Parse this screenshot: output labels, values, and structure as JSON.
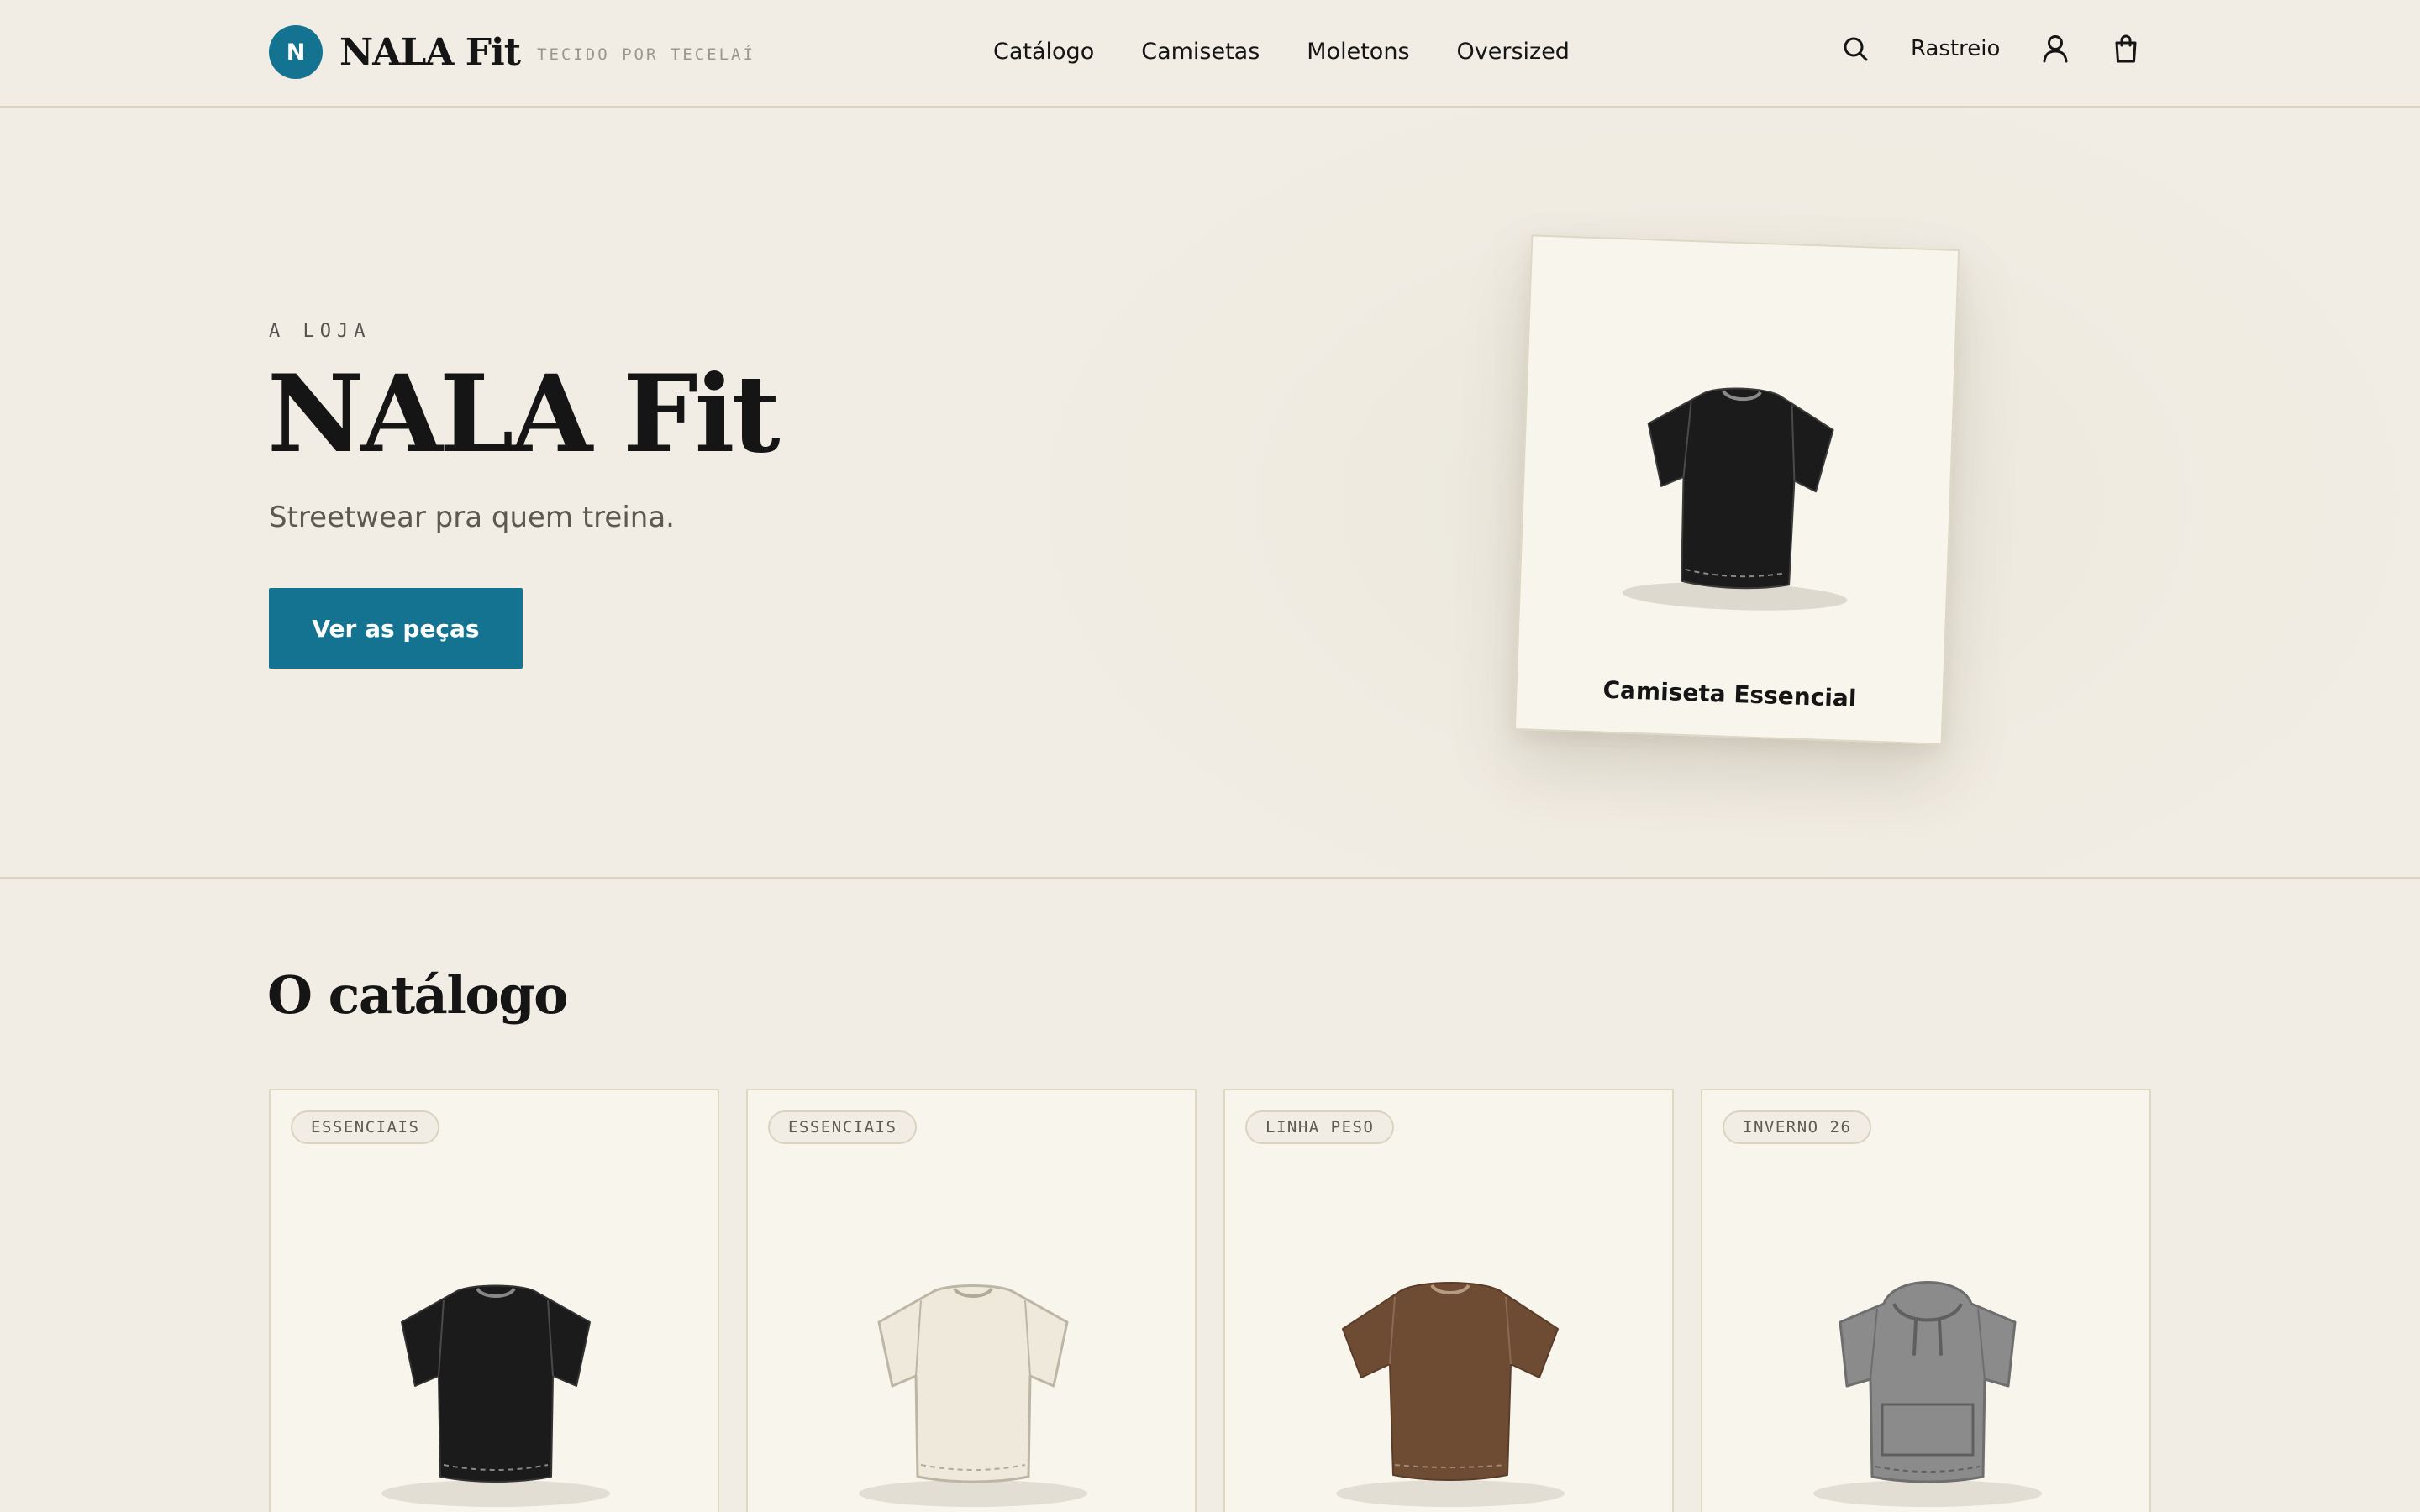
{
  "header": {
    "logo_letter": "N",
    "brand_name": "NALA Fit",
    "brand_tagline": "TECIDO POR TECELAÍ",
    "nav": [
      "Catálogo",
      "Camisetas",
      "Moletons",
      "Oversized"
    ],
    "tracking_label": "Rastreio",
    "icons": [
      "search-icon",
      "user-icon",
      "shopping-bag-icon"
    ]
  },
  "hero": {
    "eyebrow": "A LOJA",
    "title": "NALA Fit",
    "subtitle": "Streetwear pra quem treina.",
    "cta_label": "Ver as peças",
    "featured": {
      "label": "Camiseta Essencial",
      "color": "#1b1b1b"
    }
  },
  "catalog": {
    "title": "O catálogo",
    "products": [
      {
        "badge": "ESSENCIAIS",
        "type": "tshirt",
        "color": "#1b1b1b"
      },
      {
        "badge": "ESSENCIAIS",
        "type": "tshirt",
        "color": "#efe9dc"
      },
      {
        "badge": "LINHA PESO",
        "type": "tshirt-oversized",
        "color": "#6e4c34"
      },
      {
        "badge": "INVERNO 26",
        "type": "hoodie",
        "color": "#8b8b8b"
      }
    ]
  },
  "colors": {
    "accent": "#137391",
    "background": "#f1ede4",
    "card": "#f8f5ec"
  }
}
